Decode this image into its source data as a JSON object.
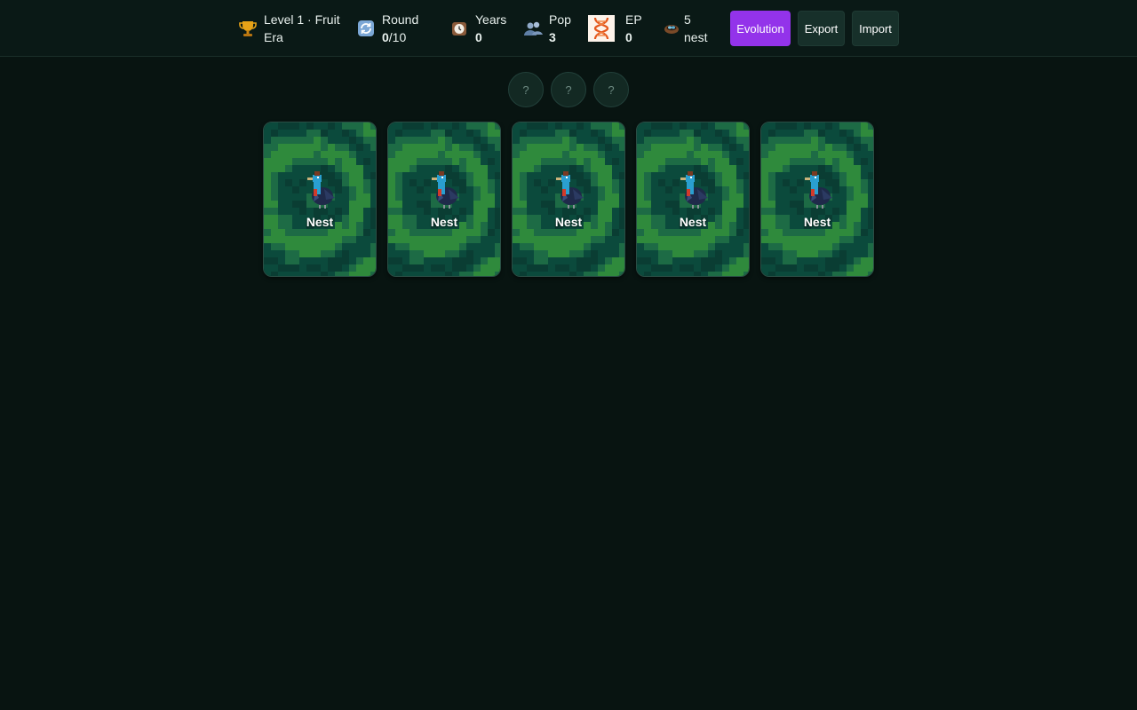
{
  "header": {
    "level": {
      "icon": "trophy-icon",
      "line1": "Level 1 · Fruit",
      "line2": "Era"
    },
    "round": {
      "icon": "cycle-icon",
      "label": "Round",
      "current": "0",
      "total": "/10"
    },
    "years": {
      "icon": "clock-icon",
      "label": "Years",
      "value": "0"
    },
    "pop": {
      "icon": "people-icon",
      "label": "Pop",
      "value": "3"
    },
    "ep": {
      "icon": "dna-icon",
      "label": "EP",
      "value": "0"
    },
    "nest": {
      "icon": "nest-icon",
      "line1": "5",
      "line2": "nest"
    }
  },
  "buttons": {
    "evolution": "Evolution",
    "export": "Export",
    "import": "Import"
  },
  "slots": [
    "?",
    "?",
    "?"
  ],
  "cards": [
    {
      "label": "Nest",
      "creature": "bird-icon"
    },
    {
      "label": "Nest",
      "creature": "bird-icon"
    },
    {
      "label": "Nest",
      "creature": "bird-icon"
    },
    {
      "label": "Nest",
      "creature": "bird-icon"
    },
    {
      "label": "Nest",
      "creature": "bird-icon"
    }
  ],
  "colors": {
    "background": "#081411",
    "accent": "#9333ea",
    "card_dark": "#0b4a3c",
    "card_light": "#2f8a3c"
  }
}
